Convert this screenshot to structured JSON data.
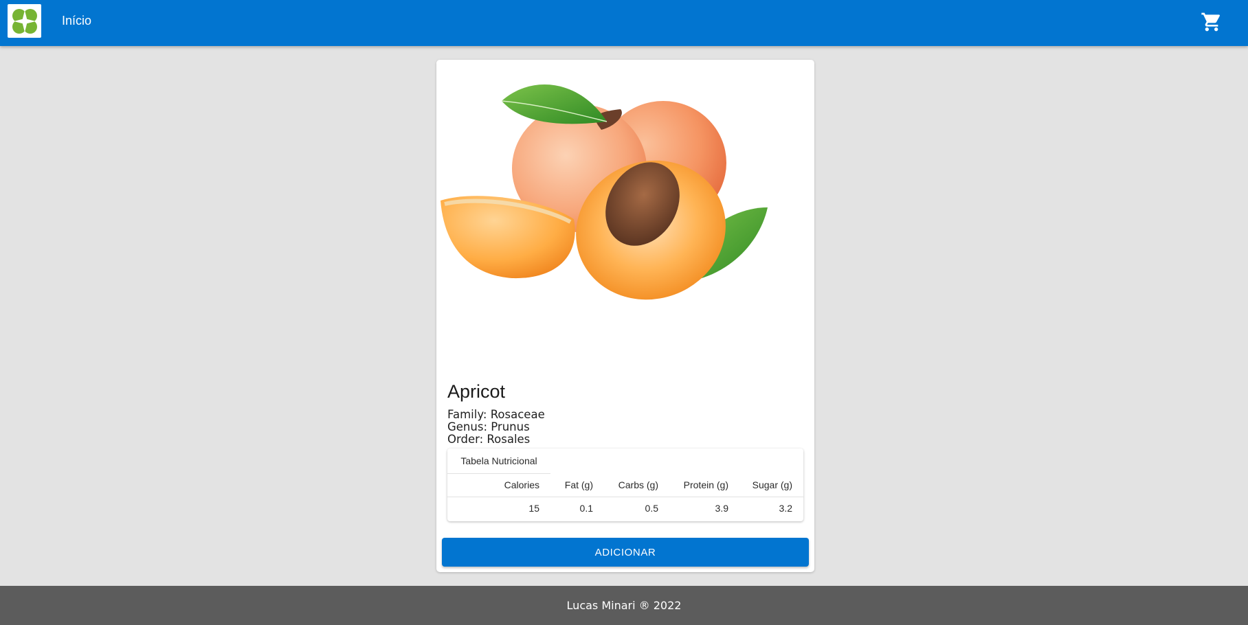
{
  "header": {
    "logo_icon": "four-leaf-logo-icon",
    "nav_home_label": "Início",
    "cart_icon": "shopping-cart-icon",
    "bar_color": "#0275d0",
    "logo_color": "#77b434"
  },
  "product": {
    "image": "apricot-photo",
    "name": "Apricot",
    "family_label": "Family:",
    "family": "Rosaceae",
    "genus_label": "Genus:",
    "genus": "Prunus",
    "order_label": "Order:",
    "order": "Rosales"
  },
  "nutrition": {
    "tab_label": "Tabela Nutricional",
    "headers": [
      "Calories",
      "Fat (g)",
      "Carbs (g)",
      "Protein (g)",
      "Sugar (g)"
    ],
    "values": [
      "15",
      "0.1",
      "0.5",
      "3.9",
      "3.2"
    ]
  },
  "actions": {
    "add_label": "ADICIONAR"
  },
  "footer": {
    "text": "Lucas Minari ® 2022"
  }
}
